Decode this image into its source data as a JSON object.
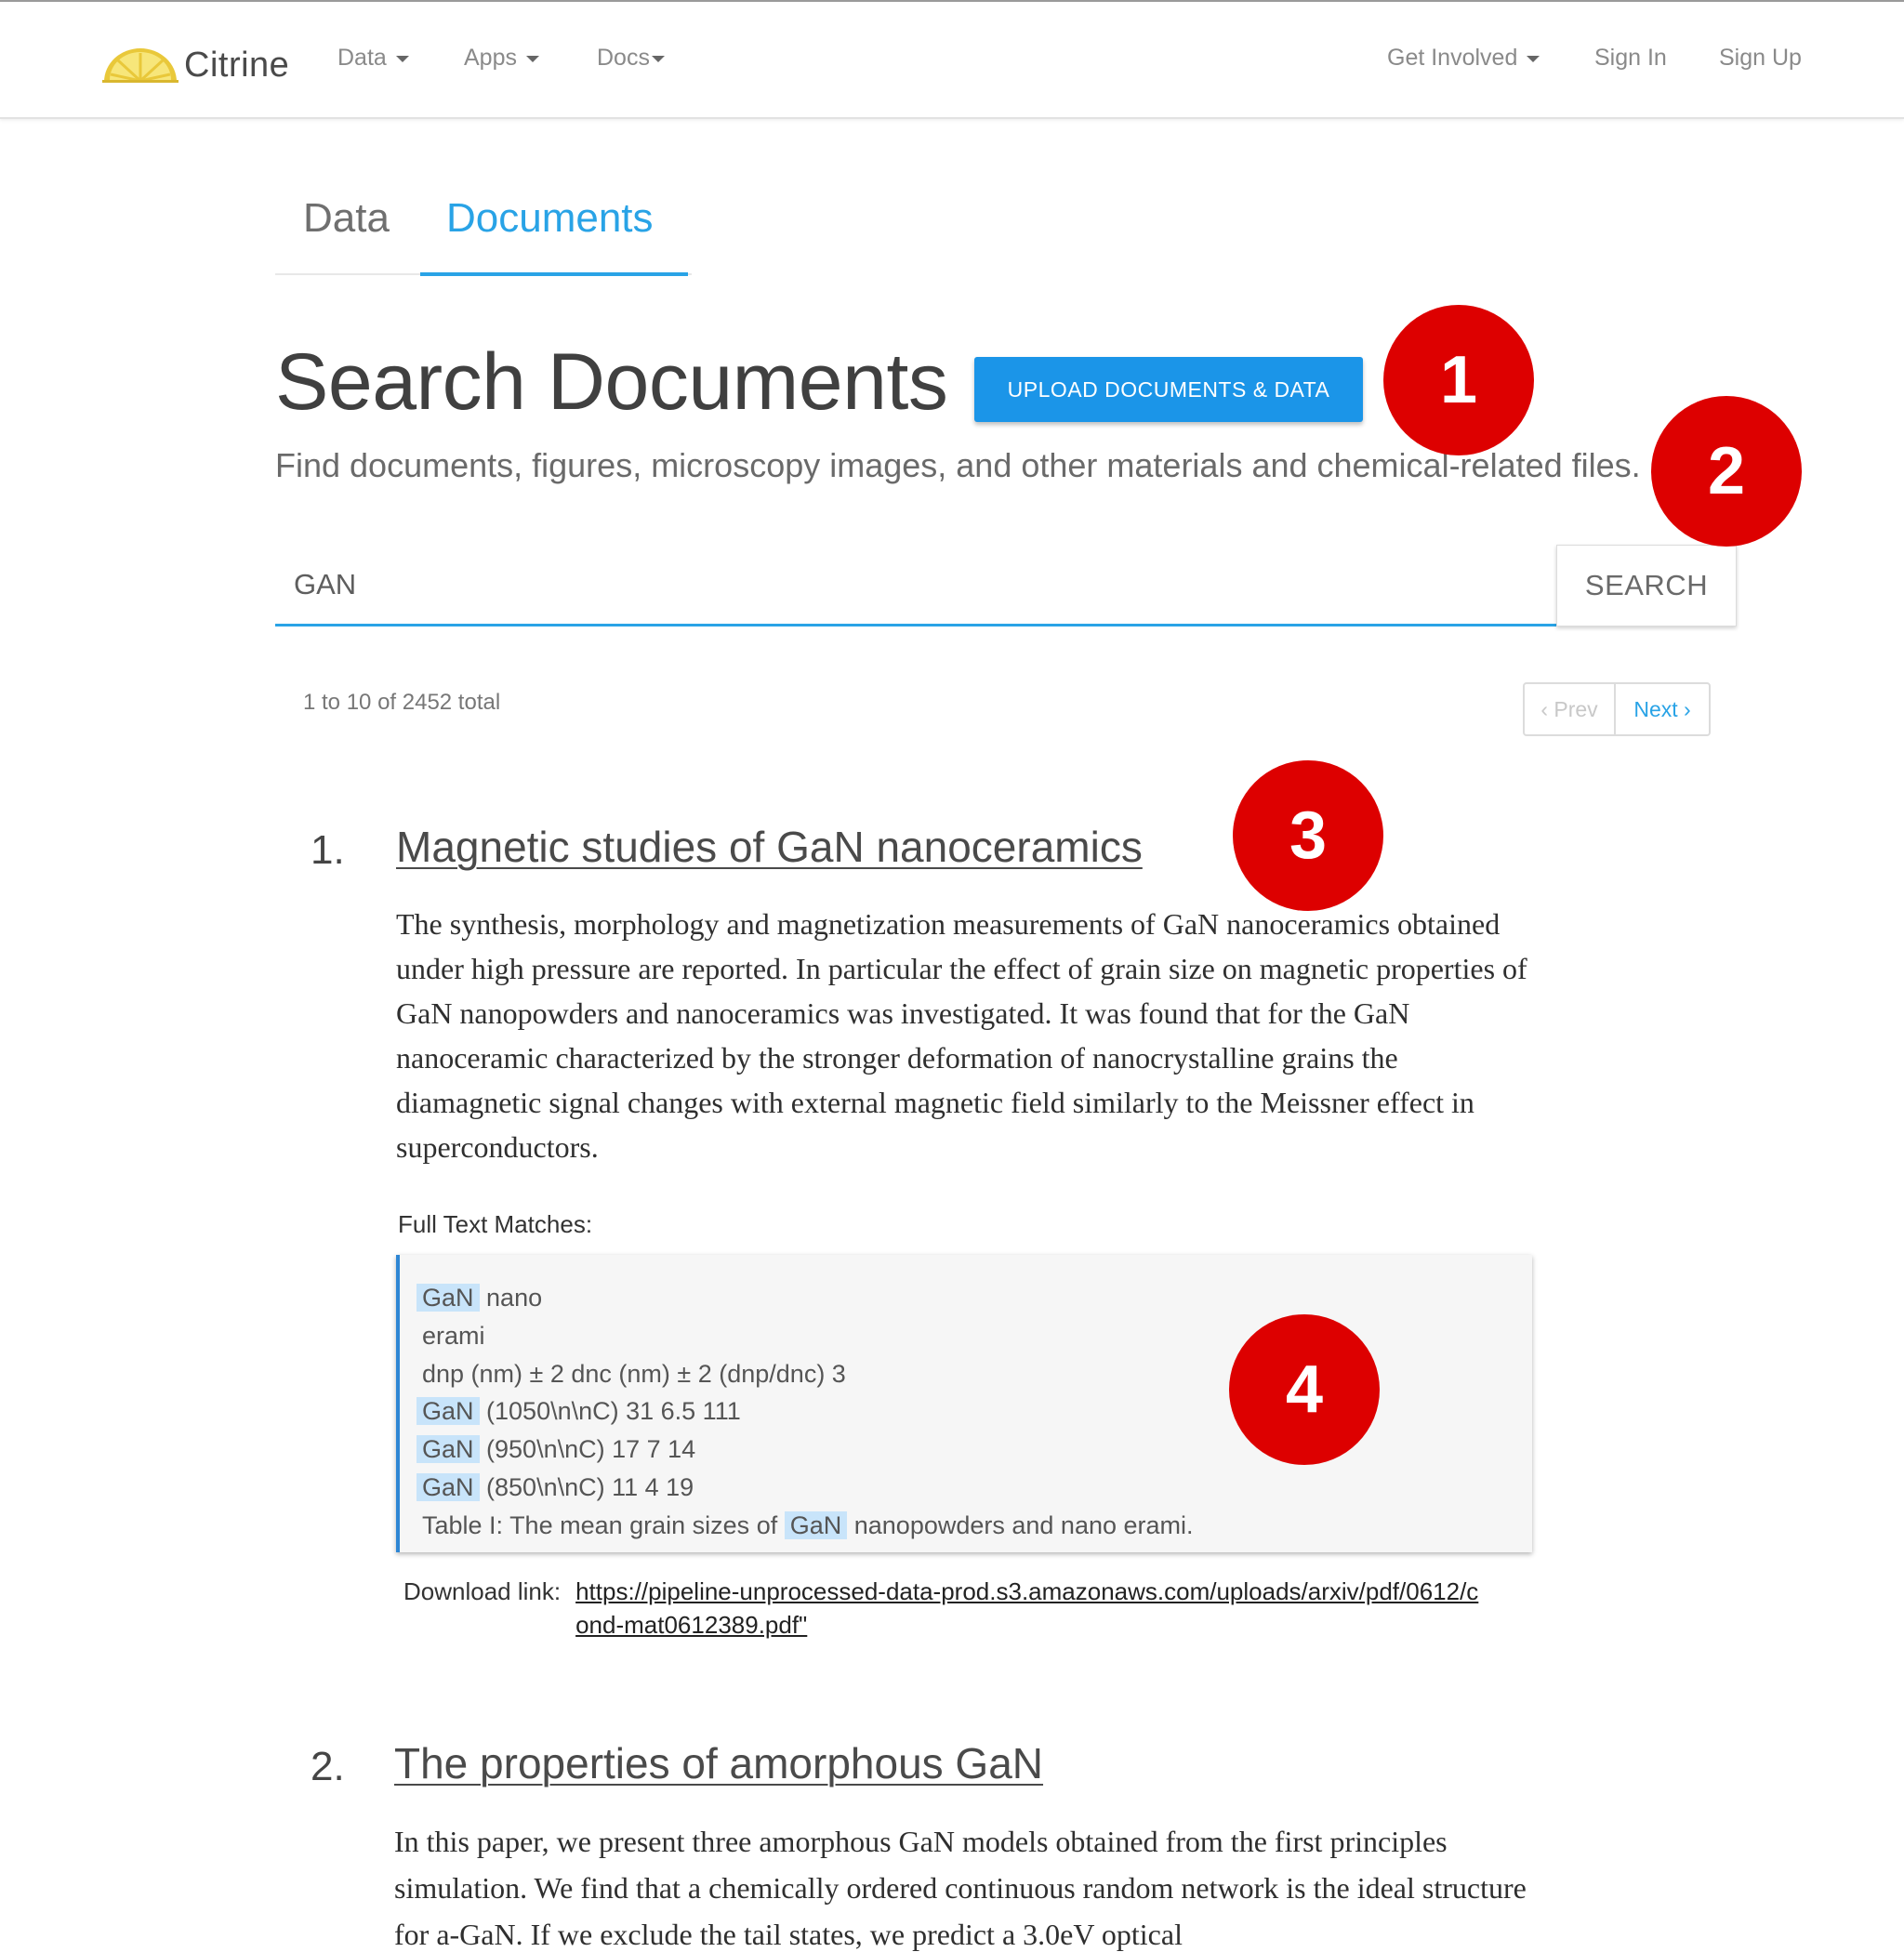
{
  "navbar": {
    "brand_name": "Citrine",
    "left_items": [
      "Data",
      "Apps",
      "Docs"
    ],
    "right_items": {
      "get_involved": "Get Involved",
      "sign_in": "Sign In",
      "sign_up": "Sign Up"
    }
  },
  "tabs": [
    {
      "label": "Data",
      "active": false
    },
    {
      "label": "Documents",
      "active": true
    }
  ],
  "page": {
    "title": "Search Documents",
    "upload_button": "UPLOAD DOCUMENTS & DATA",
    "subtitle": "Find documents, figures, microscopy images, and other materials and chemical-related files."
  },
  "search": {
    "value": "GAN",
    "button": "SEARCH"
  },
  "results_meta": {
    "count_text": "1 to 10 of 2452 total",
    "prev_label": "‹ Prev",
    "next_label": "Next ›"
  },
  "results": [
    {
      "number": "1.",
      "title": "Magnetic studies of GaN nanoceramics",
      "abstract": "The synthesis, morphology and magnetization measurements of GaN nanoceramics obtained under high pressure are reported. In particular the effect of grain size on magnetic properties of GaN nanopowders and nanoceramics was investigated. It was found that for the GaN nanoceramic characterized by the stronger deformation of nanocrystalline grains the diamagnetic signal changes with external magnetic field similarly to the Meissner effect in superconductors.",
      "full_text_label": "Full Text Matches:",
      "matches": [
        {
          "hl": "GaN",
          "rest": " nano",
          "pre": ""
        },
        {
          "hl": "",
          "rest": "erami",
          "pre": ""
        },
        {
          "hl": "",
          "rest": "dnp (nm) ± 2 dnc (nm) ± 2 (dnp/dnc) 3",
          "pre": ""
        },
        {
          "hl": "GaN",
          "rest": " (1050\\n\\nC) 31 6.5 111",
          "pre": ""
        },
        {
          "hl": "GaN",
          "rest": " (950\\n\\nC) 17 7 14",
          "pre": ""
        },
        {
          "hl": "GaN",
          "rest": " (850\\n\\nC) 11 4 19",
          "pre": ""
        },
        {
          "pre": "Table I: The mean grain sizes of ",
          "hl": "GaN",
          "rest": " nanopowders and nano erami."
        }
      ],
      "download_label": "Download link:",
      "download_url": "https://pipeline-unprocessed-data-prod.s3.amazonaws.com/uploads/arxiv/pdf/0612/cond-mat0612389.pdf\""
    },
    {
      "number": "2.",
      "title": "The properties of amorphous GaN",
      "abstract": "In this paper, we present three amorphous GaN models obtained from the first principles simulation. We find that a chemically ordered continuous random network is the ideal structure for a-GaN. If we exclude the tail states, we predict a 3.0eV optical"
    }
  ],
  "annotations": [
    "1",
    "2",
    "3",
    "4"
  ],
  "colors": {
    "accent": "#29a3e6",
    "upload_button": "#1b95e8",
    "badge": "#dd0000",
    "highlight": "#c8e4fa",
    "brand_lemon": "#f2d84b"
  },
  "icons": {
    "brand_logo": "lemon-slice-icon",
    "dropdown": "caret-down-icon"
  }
}
